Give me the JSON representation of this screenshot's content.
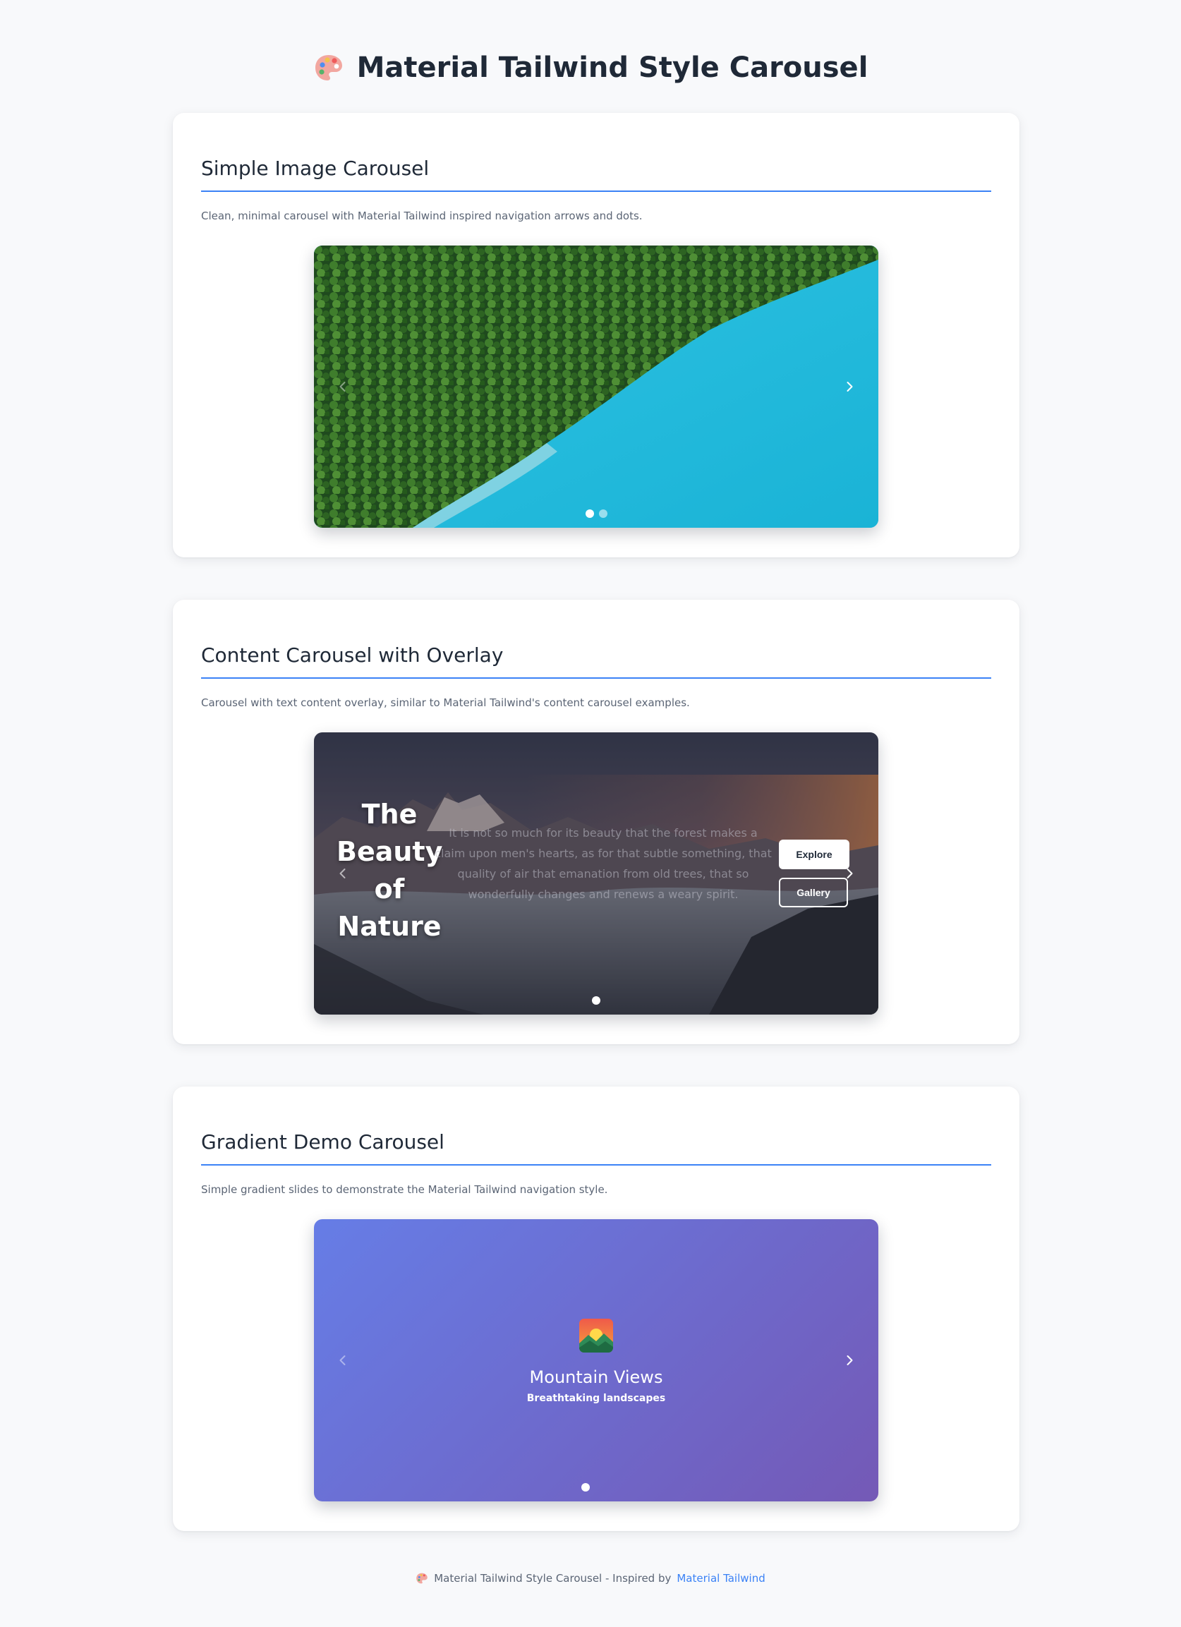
{
  "page": {
    "title": "Material Tailwind Style Carousel",
    "title_icon": "artist-palette-icon"
  },
  "sections": [
    {
      "title": "Simple Image Carousel",
      "description": "Clean, minimal carousel with Material Tailwind inspired navigation arrows and dots.",
      "slides": [
        {
          "image": "aerial view of forest and turquoise lake"
        }
      ],
      "dots": 2,
      "active_dot": 1
    },
    {
      "title": "Content Carousel with Overlay",
      "description": "Carousel with text content overlay, similar to Material Tailwind's content carousel examples.",
      "slide": {
        "image": "mountain peaks above clouds at sunset",
        "heading": "The Beauty of Nature",
        "text": "It is not so much for its beauty that the forest makes a claim upon men's hearts, as for that subtle something, that quality of air that emanation from old trees, that so wonderfully changes and renews a weary spirit.",
        "primary_button": "Explore",
        "secondary_button": "Gallery"
      },
      "dots": 1,
      "active_dot": 1
    },
    {
      "title": "Gradient Demo Carousel",
      "description": "Simple gradient slides to demonstrate the Material Tailwind navigation style.",
      "slide": {
        "icon": "sunrise-over-mountains-icon",
        "title": "Mountain Views",
        "subtitle": "Breathtaking landscapes"
      },
      "gradient": {
        "from": "#667de6",
        "to": "#7459b6"
      },
      "dots": 1,
      "active_dot": 1
    }
  ],
  "footer": {
    "text": "Material Tailwind Style Carousel - Inspired by",
    "link_label": "Material Tailwind",
    "icon": "artist-palette-icon"
  },
  "colors": {
    "accent": "#3b82f6",
    "background": "#f8f9fb",
    "card": "#ffffff",
    "heading": "#1f2937",
    "muted": "#5b6575"
  }
}
